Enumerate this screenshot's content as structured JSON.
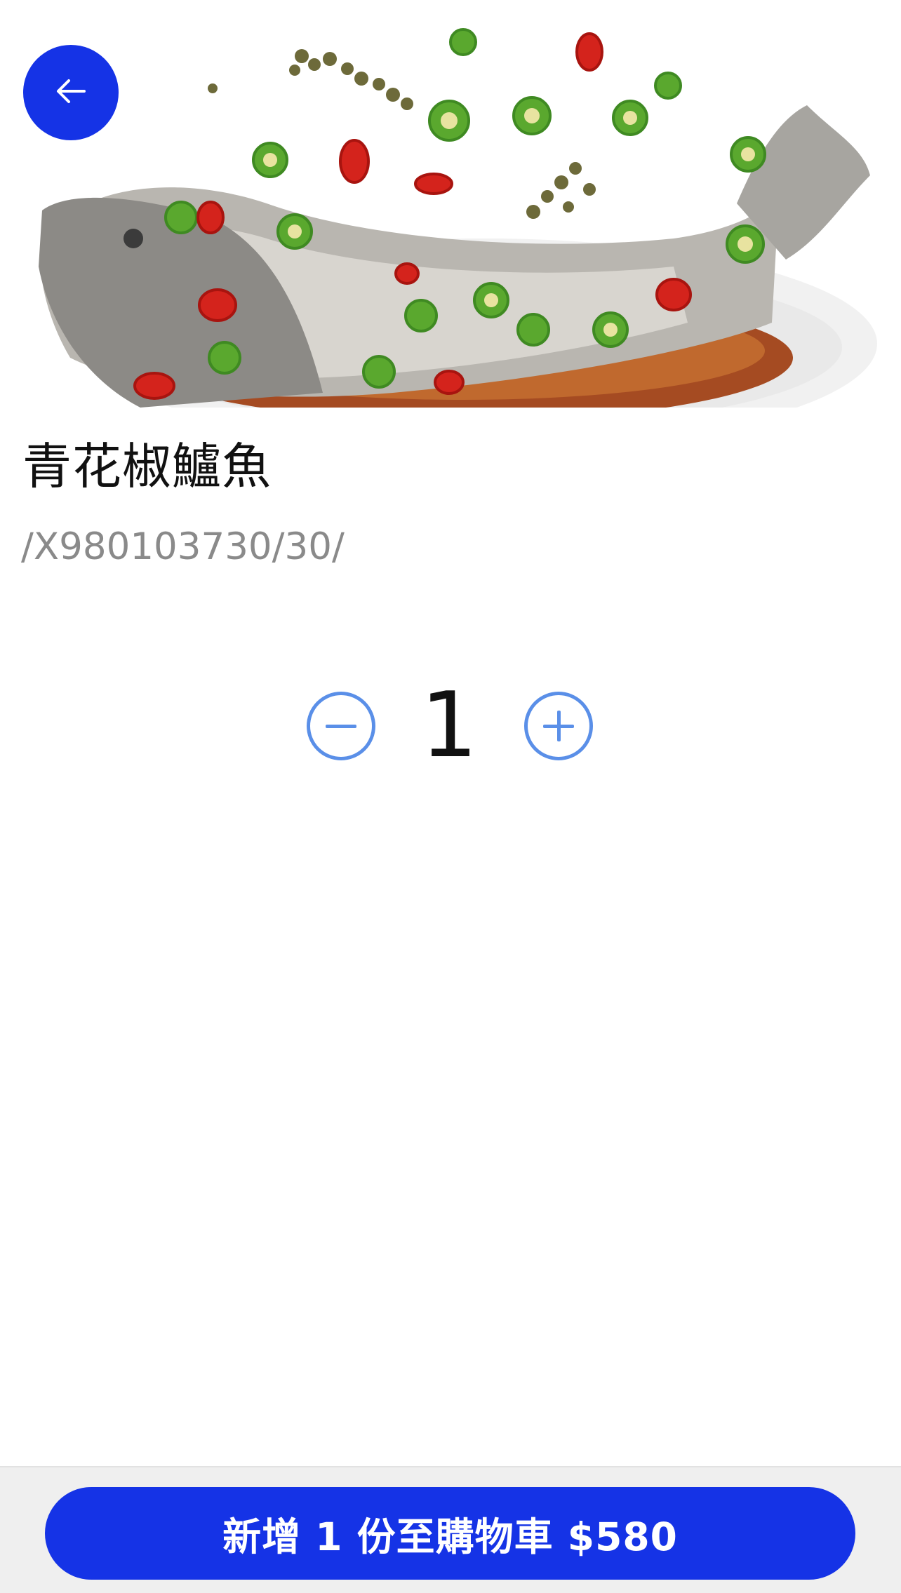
{
  "header": {
    "back_icon": "arrow-left-icon",
    "accent_color": "#1533e6"
  },
  "product": {
    "image_icon": "steamed-fish-photo",
    "title": "青花椒鱸魚",
    "code": "/X980103730/30/"
  },
  "quantity": {
    "value": "1",
    "decrease_icon": "minus-circle-icon",
    "increase_icon": "plus-circle-icon"
  },
  "footer": {
    "add_to_cart_label": "新增 1 份至購物車 $580"
  }
}
